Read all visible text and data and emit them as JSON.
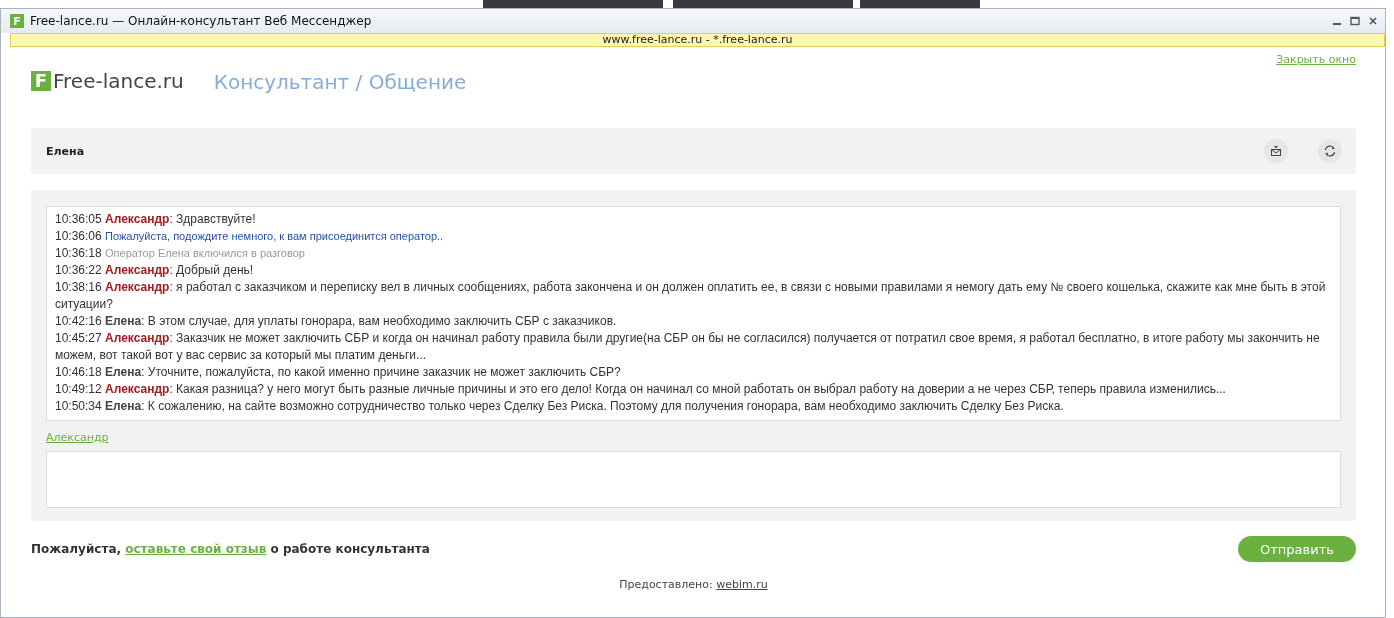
{
  "window": {
    "title": "Free-lance.ru — Онлайн-консультант Веб Мессенджер",
    "address": "www.free-lance.ru - *.free-lance.ru",
    "icon_letter": "F"
  },
  "header": {
    "logo_letter": "F",
    "logo_text": "Free-lance.ru",
    "page_title": "Консультант / Общение",
    "close_link": "Закрыть окно"
  },
  "operator": {
    "name": "Елена"
  },
  "messages": [
    {
      "kind": "visitor",
      "time": "10:36:05",
      "author": "Александр",
      "text": ": Здравствуйте!"
    },
    {
      "kind": "info",
      "time": "10:36:06",
      "text": "Пожалуйста, подождите немного, к вам присоединится оператор.."
    },
    {
      "kind": "notice",
      "time": "10:36:18",
      "text": "Оператор Елена включился в разговор"
    },
    {
      "kind": "visitor",
      "time": "10:36:22",
      "author": "Александр",
      "text": ": Добрый день!"
    },
    {
      "kind": "visitor",
      "time": "10:38:16",
      "author": "Александр",
      "text": ": я работал с заказчиком и переписку вел в личных сообщениях, работа закончена и он должен оплатить ее, в связи с новыми правилами я немогу дать ему № своего кошелька, скажите как мне быть в этой ситуации?"
    },
    {
      "kind": "operator",
      "time": "10:42:16",
      "author": "Елена",
      "text": ": В этом случае, для уплаты гонорара, вам необходимо заключить СБР с заказчиков."
    },
    {
      "kind": "visitor",
      "time": "10:45:27",
      "author": "Александр",
      "text": ": Заказчик не может заключить СБР и когда он начинал работу правила были другие(на СБР он бы не согласился) получается от потратил свое время, я работал бесплатно, в итоге работу мы закончить не можем, вот такой вот у вас сервис за который мы платим деньги..."
    },
    {
      "kind": "operator",
      "time": "10:46:18",
      "author": "Елена",
      "text": ": Уточните, пожалуйста, по какой именно причине заказчик не может заключить СБР?"
    },
    {
      "kind": "visitor",
      "time": "10:49:12",
      "author": "Александр",
      "text": ": Какая разница? у него могут быть разные личные причины и это его дело! Когда он начинал со мной работать он выбрал работу на доверии а не через СБР, теперь правила изменились..."
    },
    {
      "kind": "operator",
      "time": "10:50:34",
      "author": "Елена",
      "text": ": К сожалению, на сайте возможно сотрудничество только через Сделку Без Риска. Поэтому для получения гонорара, вам необходимо заключить Сделку Без Риска."
    }
  ],
  "visitor_name_link": "Александр",
  "feedback": {
    "before": "Пожалуйста,",
    "link": "оставьте свой отзыв",
    "after": "о работе консультанта"
  },
  "send_button": "Отправить",
  "powered_by": {
    "label": "Предоставлено:",
    "link": "webim.ru"
  }
}
